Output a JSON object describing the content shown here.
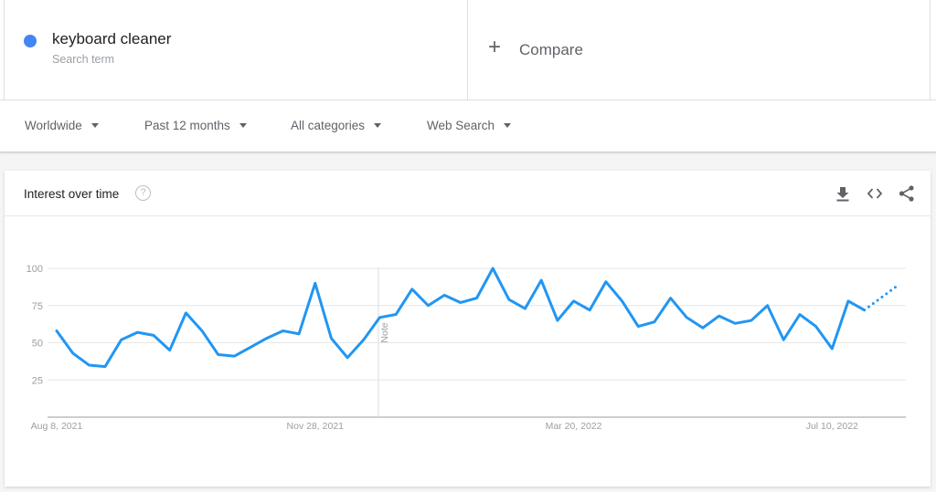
{
  "search_term": {
    "name": "keyboard cleaner",
    "subtitle": "Search term",
    "color": "#4285f4"
  },
  "compare": {
    "icon": "plus-icon",
    "label": "Compare"
  },
  "filters": [
    {
      "label": "Worldwide"
    },
    {
      "label": "Past 12 months"
    },
    {
      "label": "All categories"
    },
    {
      "label": "Web Search"
    }
  ],
  "card": {
    "title": "Interest over time",
    "help_glyph": "?",
    "actions": [
      {
        "name": "download-icon"
      },
      {
        "name": "embed-icon"
      },
      {
        "name": "share-icon"
      }
    ]
  },
  "chart_data": {
    "type": "line",
    "title": "Interest over time",
    "xlabel": "",
    "ylabel": "",
    "ylim": [
      0,
      100
    ],
    "yticks": [
      25,
      50,
      75,
      100
    ],
    "x_tick_labels": [
      {
        "label": "Aug 8, 2021",
        "index": 0
      },
      {
        "label": "Nov 28, 2021",
        "index": 16
      },
      {
        "label": "Mar 20, 2022",
        "index": 32
      },
      {
        "label": "Jul 10, 2022",
        "index": 48
      }
    ],
    "grid": true,
    "note_marker": {
      "label": "Note",
      "index": 20
    },
    "line_color": "#2196f3",
    "series": [
      {
        "name": "keyboard cleaner",
        "values": [
          58,
          43,
          35,
          34,
          52,
          57,
          55,
          45,
          70,
          58,
          42,
          41,
          47,
          53,
          58,
          56,
          90,
          53,
          40,
          52,
          67,
          69,
          86,
          75,
          82,
          77,
          80,
          100,
          79,
          73,
          92,
          65,
          78,
          72,
          91,
          78,
          61,
          64,
          80,
          67,
          60,
          68,
          63,
          65,
          75,
          52,
          69,
          61,
          46,
          78,
          72,
          80,
          88
        ],
        "partial_from_index": 50
      }
    ]
  }
}
